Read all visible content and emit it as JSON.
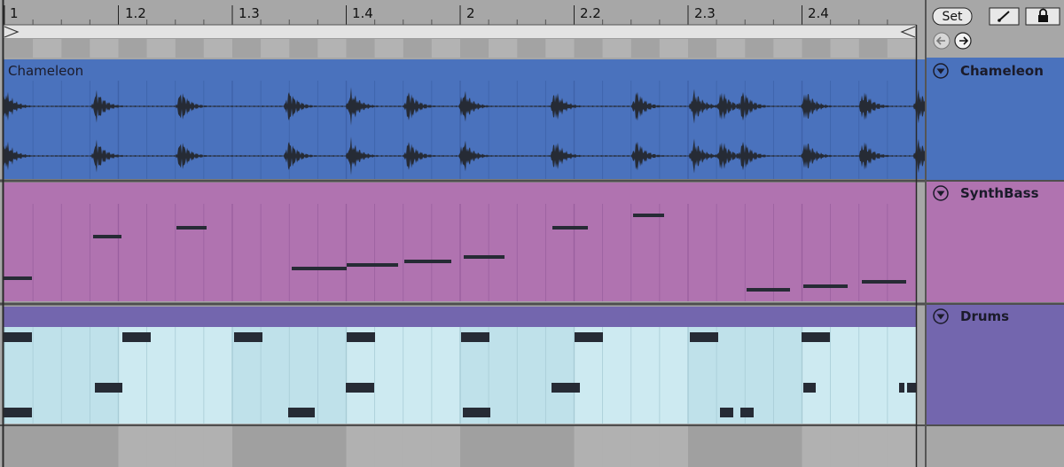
{
  "ruler": {
    "labels": [
      "1",
      "1.2",
      "1.3",
      "1.4",
      "2",
      "2.2",
      "2.3",
      "2.4"
    ]
  },
  "controls": {
    "set_label": "Set",
    "pencil_icon": "pencil-icon",
    "lock_icon": "lock-icon",
    "back_icon": "arrow-left-icon",
    "forward_icon": "arrow-right-icon"
  },
  "tracks": [
    {
      "name": "Chameleon",
      "clip_name": "Chameleon",
      "color": "#4a72bd",
      "type": "audio"
    },
    {
      "name": "SynthBass",
      "clip_name": "",
      "color": "#b073b0",
      "type": "midi"
    },
    {
      "name": "Drums",
      "clip_name": "",
      "color": "#7366ae",
      "type": "midi"
    }
  ],
  "colors": {
    "audio_clip": "#4a72bd",
    "synth_clip": "#b073b0",
    "drums_header": "#7366ae",
    "drums_body": "#cdeaf1",
    "note": "#262b35"
  }
}
